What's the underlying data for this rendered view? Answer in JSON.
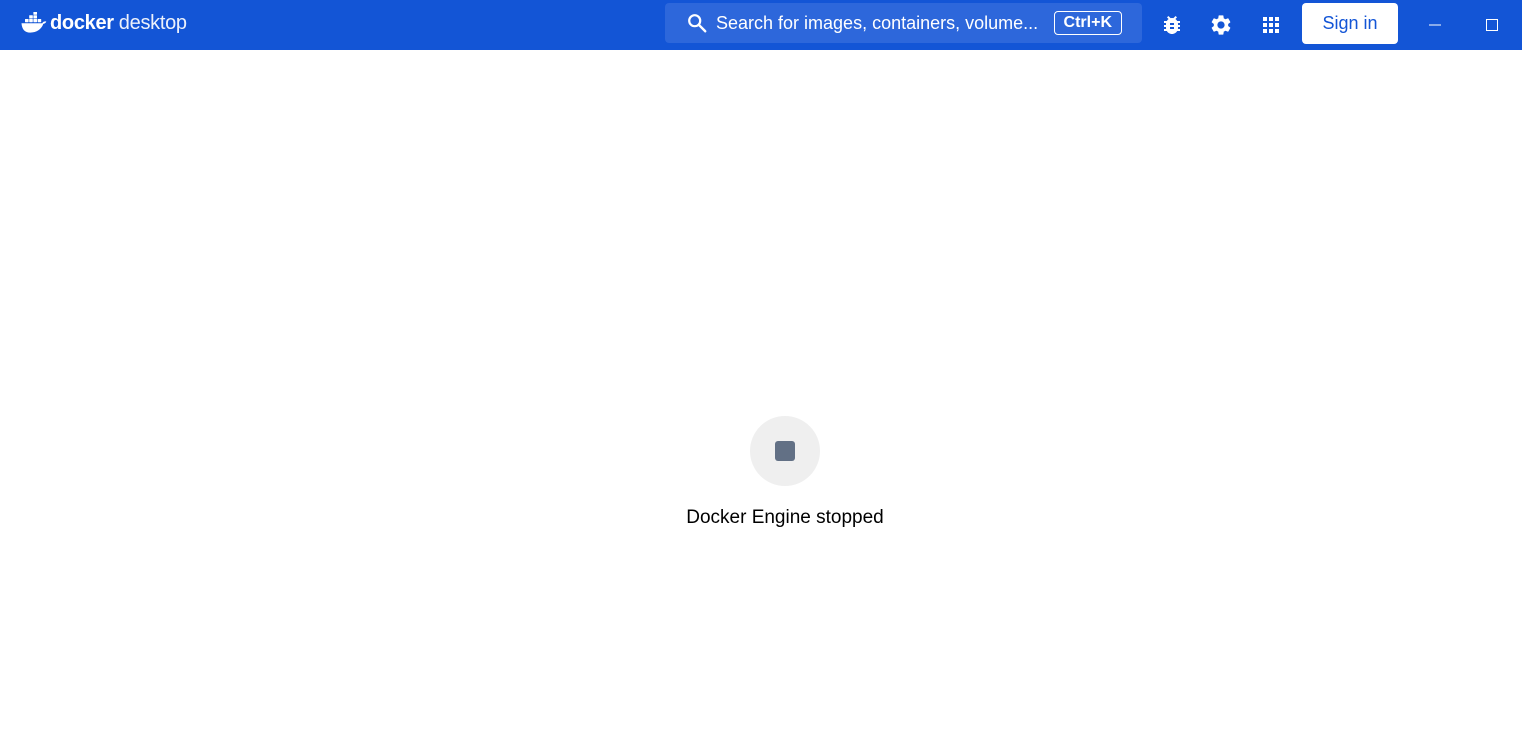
{
  "app": {
    "brand_bold": "docker",
    "brand_light": "desktop"
  },
  "search": {
    "placeholder": "Search for images, containers, volume...",
    "shortcut": "Ctrl+K"
  },
  "toolbar": {
    "icons": [
      "bug-icon",
      "gear-icon",
      "apps-grid-icon"
    ],
    "signin_label": "Sign in"
  },
  "window_controls": {
    "icons": [
      "minimize-icon",
      "maximize-icon"
    ]
  },
  "engine": {
    "status_text": "Docker Engine stopped",
    "icon": "stop-icon"
  },
  "colors": {
    "titlebar": "#1355d6",
    "search_bg": "#2d67db",
    "stop_icon": "#627085",
    "status_circle": "#efefef"
  }
}
